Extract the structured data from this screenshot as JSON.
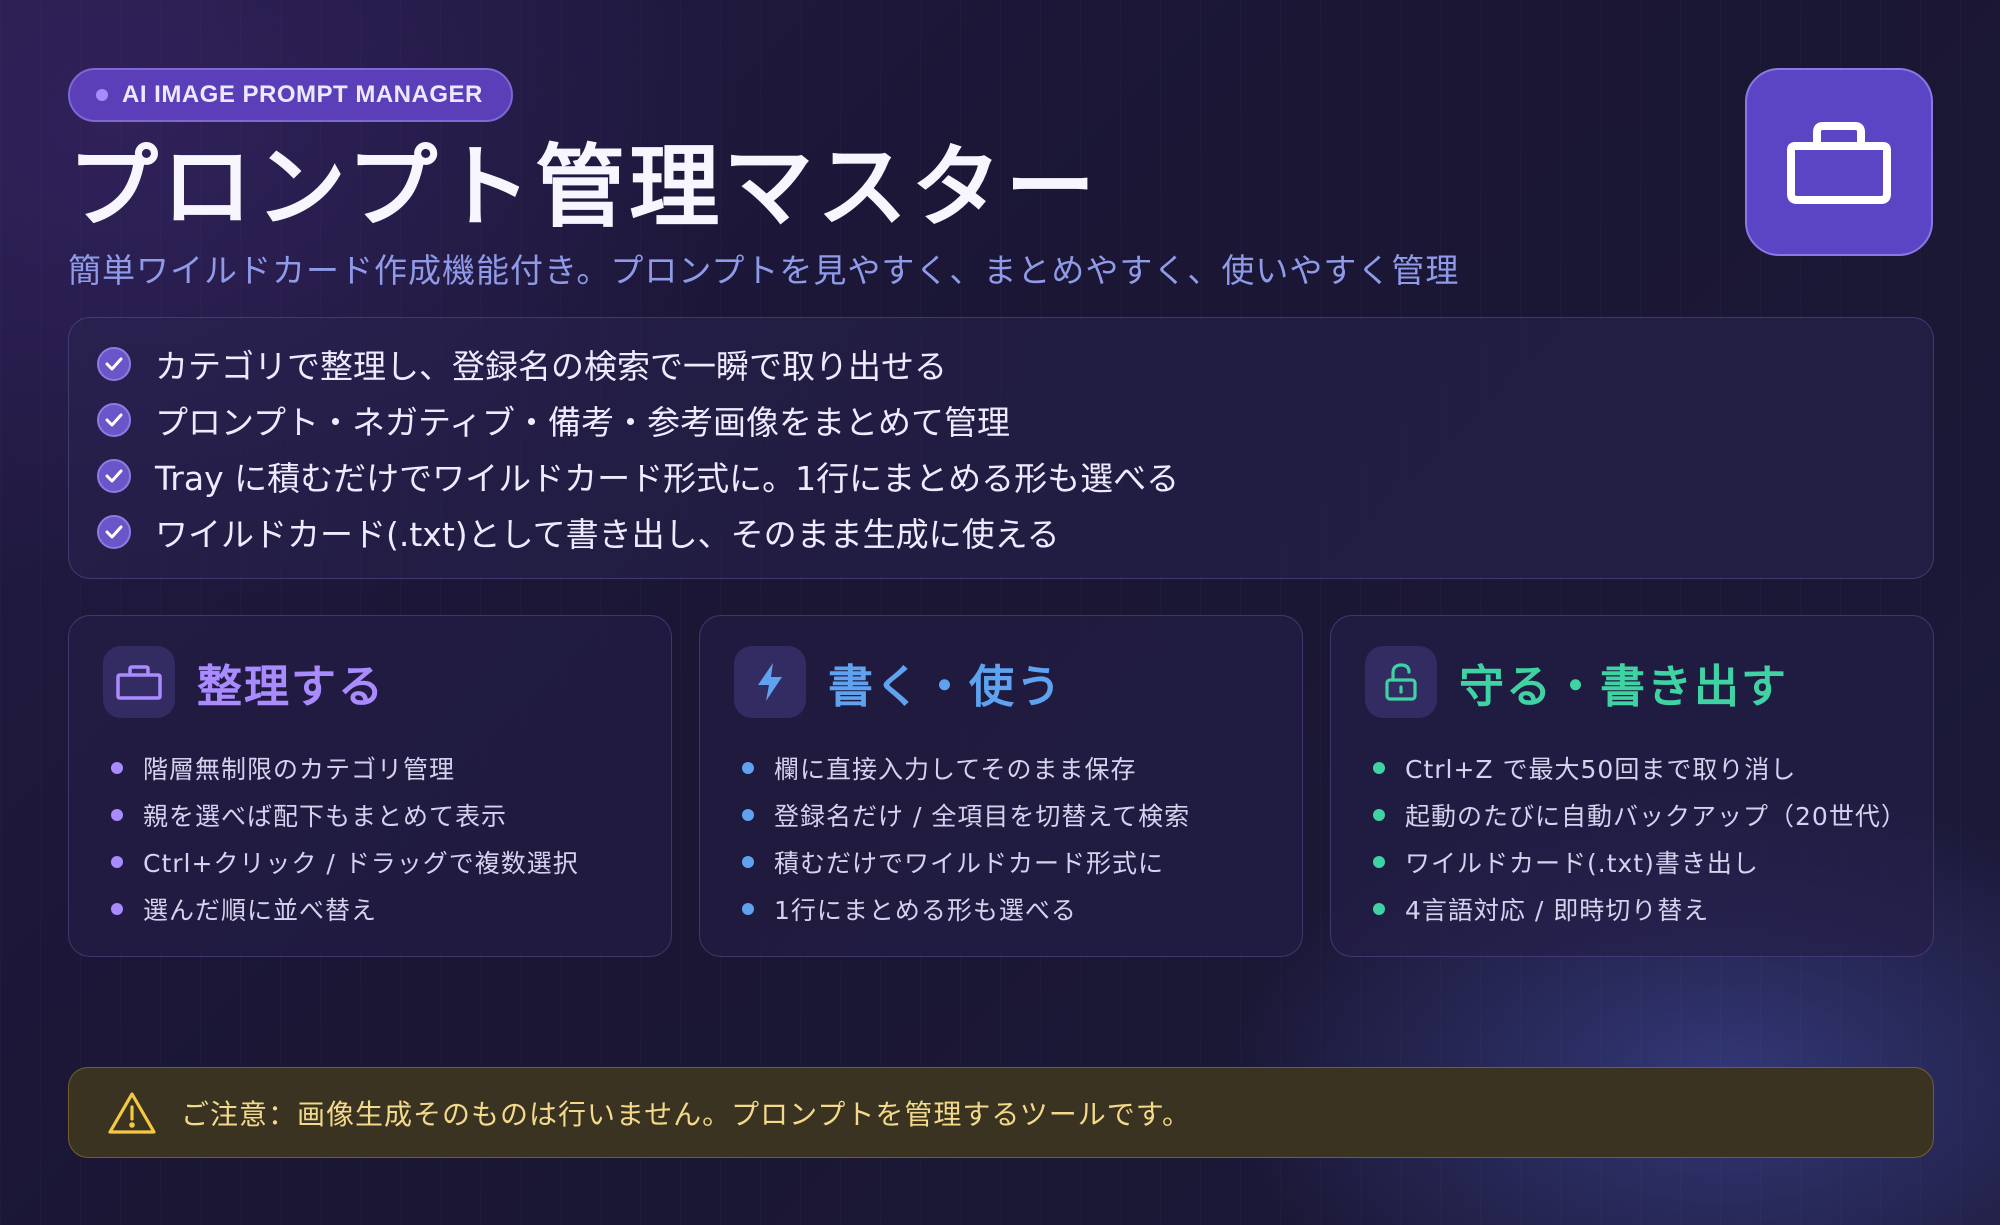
{
  "header": {
    "badge_label": "AI IMAGE PROMPT MANAGER",
    "title": "プロンプト管理マスター",
    "subtitle": "簡単ワイルドカード作成機能付き。プロンプトを見やすく、まとめやすく、使いやすく管理",
    "app_icon": "folder-icon"
  },
  "highlights": [
    "カテゴリで整理し、登録名の検索で一瞬で取り出せる",
    "プロンプト・ネガティブ・備考・参考画像をまとめて管理",
    "Tray に積むだけでワイルドカード形式に。1行にまとめる形も選べる",
    "ワイルドカード(.txt)として書き出し、そのまま生成に使える"
  ],
  "cards": [
    {
      "title": "整理する",
      "icon": "folder-icon",
      "accent": "#a98bff",
      "items": [
        "階層無制限のカテゴリ管理",
        "親を選べば配下もまとめて表示",
        "Ctrl+クリック / ドラッグで複数選択",
        "選んだ順に並べ替え"
      ]
    },
    {
      "title": "書く・使う",
      "icon": "lightning-icon",
      "accent": "#5fa2f0",
      "items": [
        "欄に直接入力してそのまま保存",
        "登録名だけ / 全項目を切替えて検索",
        "積むだけでワイルドカード形式に",
        "1行にまとめる形も選べる"
      ]
    },
    {
      "title": "守る・書き出す",
      "icon": "unlock-icon",
      "accent": "#3fd3a4",
      "items": [
        "Ctrl+Z で最大50回まで取り消し",
        "起動のたびに自動バックアップ（20世代）",
        "ワイルドカード(.txt)書き出し",
        "4言語対応 / 即時切り替え"
      ]
    }
  ],
  "notice": {
    "icon": "warning-icon",
    "text": "ご注意：画像生成そのものは行いません。プロンプトを管理するツールです。"
  },
  "colors": {
    "background": "#1c1736",
    "brand": "#5b45c4",
    "notice_text": "#f3d98a"
  }
}
